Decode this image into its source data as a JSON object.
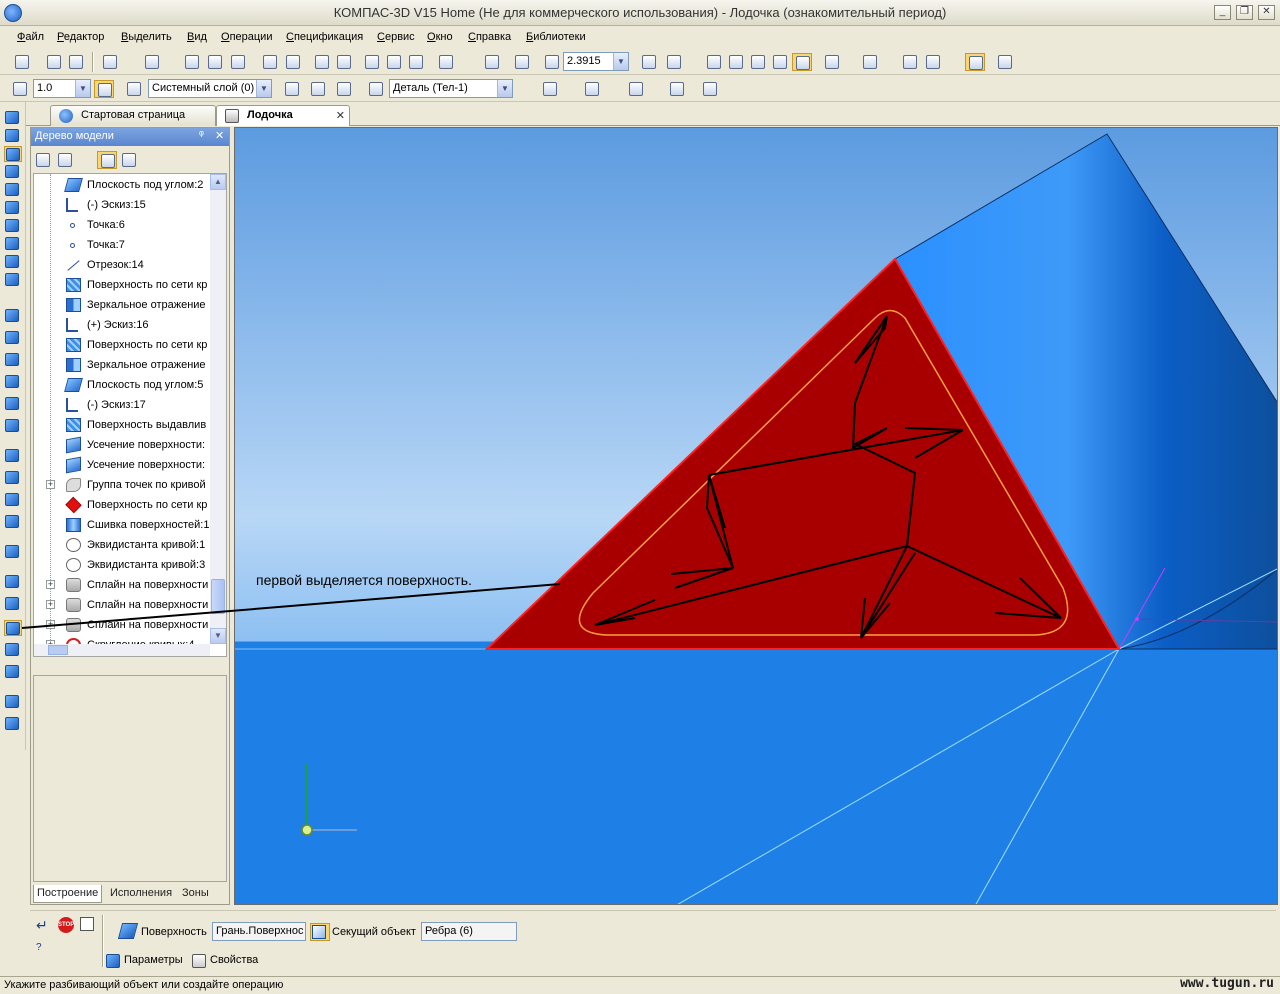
{
  "window": {
    "title": "КОМПАС-3D V15 Home (Не для коммерческого использования) - Лодочка (ознакомительный период)",
    "minimize": "_",
    "restore": "❐",
    "close": "✕"
  },
  "menu": [
    "Файл",
    "Редактор",
    "Выделить",
    "Вид",
    "Операции",
    "Спецификация",
    "Сервис",
    "Окно",
    "Справка",
    "Библиотеки"
  ],
  "toolbar1": {
    "zoom_value": "2.3915"
  },
  "toolbar2": {
    "step_value": "1.0",
    "layer_value": "Системный слой (0)",
    "detail_value": "Деталь (Тел-1)"
  },
  "doc_tabs": [
    {
      "label": "Стартовая страница",
      "active": false
    },
    {
      "label": "Лодочка",
      "active": true
    }
  ],
  "tree": {
    "header": "Дерево модели",
    "pin": "ᵠ",
    "close": "✕",
    "items": [
      {
        "label": "Плоскость под углом:2",
        "icon": "plane-icon",
        "expandable": false
      },
      {
        "label": "(-) Эскиз:15",
        "icon": "sketch-icon",
        "expandable": false
      },
      {
        "label": "Точка:6",
        "icon": "point-icon",
        "expandable": false
      },
      {
        "label": "Точка:7",
        "icon": "point-icon",
        "expandable": false
      },
      {
        "label": "Отрезок:14",
        "icon": "segment-icon",
        "expandable": false
      },
      {
        "label": "Поверхность по сети кр",
        "icon": "surface-icon",
        "expandable": false
      },
      {
        "label": "Зеркальное отражение",
        "icon": "mirror-icon",
        "expandable": false
      },
      {
        "label": "(+) Эскиз:16",
        "icon": "sketch-icon",
        "expandable": false
      },
      {
        "label": "Поверхность по сети кр",
        "icon": "surface-icon",
        "expandable": false
      },
      {
        "label": "Зеркальное отражение",
        "icon": "mirror-icon",
        "expandable": false
      },
      {
        "label": "Плоскость под углом:5",
        "icon": "plane-icon",
        "expandable": false
      },
      {
        "label": "(-) Эскиз:17",
        "icon": "sketch-icon",
        "expandable": false
      },
      {
        "label": "Поверхность выдавлив",
        "icon": "surface-icon",
        "expandable": false
      },
      {
        "label": "Усечение поверхности:",
        "icon": "cut-icon",
        "expandable": false
      },
      {
        "label": "Усечение поверхности:",
        "icon": "cut-icon",
        "expandable": false
      },
      {
        "label": "Группа точек по кривой",
        "icon": "group-icon",
        "expandable": true
      },
      {
        "label": "Поверхность по сети кр",
        "icon": "red-surface-icon",
        "expandable": false
      },
      {
        "label": "Сшивка поверхностей:1",
        "icon": "sew-icon",
        "expandable": false
      },
      {
        "label": "Эквидистанта кривой:1",
        "icon": "equidistant-icon",
        "expandable": false
      },
      {
        "label": "Эквидистанта кривой:3",
        "icon": "equidistant-icon",
        "expandable": false
      },
      {
        "label": "Сплайн на поверхности",
        "icon": "spline-icon",
        "expandable": true
      },
      {
        "label": "Сплайн на поверхности",
        "icon": "spline-icon",
        "expandable": true
      },
      {
        "label": "Сплайн на поверхности",
        "icon": "spline-icon",
        "expandable": true
      },
      {
        "label": "Скругление кривых:4",
        "icon": "round-icon",
        "expandable": true
      }
    ],
    "bottom_tabs": [
      "Построение",
      "Исполнения",
      "Зоны"
    ]
  },
  "viewport": {
    "annotation": "первой выделяется поверхность.",
    "colors": {
      "background_top": "#5c9be0",
      "background_mid": "#b8d7f6",
      "floor": "#1e7fe6",
      "selected_face": "#a80000",
      "selected_edge": "#ff2020",
      "contour": "#ffb040"
    }
  },
  "properties": {
    "surface_label": "Поверхность",
    "surface_value": "Грань.Поверхнос",
    "cutting_label": "Секущий объект",
    "cutting_value": "Ребра (6)",
    "tab_params": "Параметры",
    "tab_props": "Свойства"
  },
  "status": {
    "text": "Укажите разбивающий объект или создайте операцию",
    "watermark": "www.tugun.ru"
  }
}
